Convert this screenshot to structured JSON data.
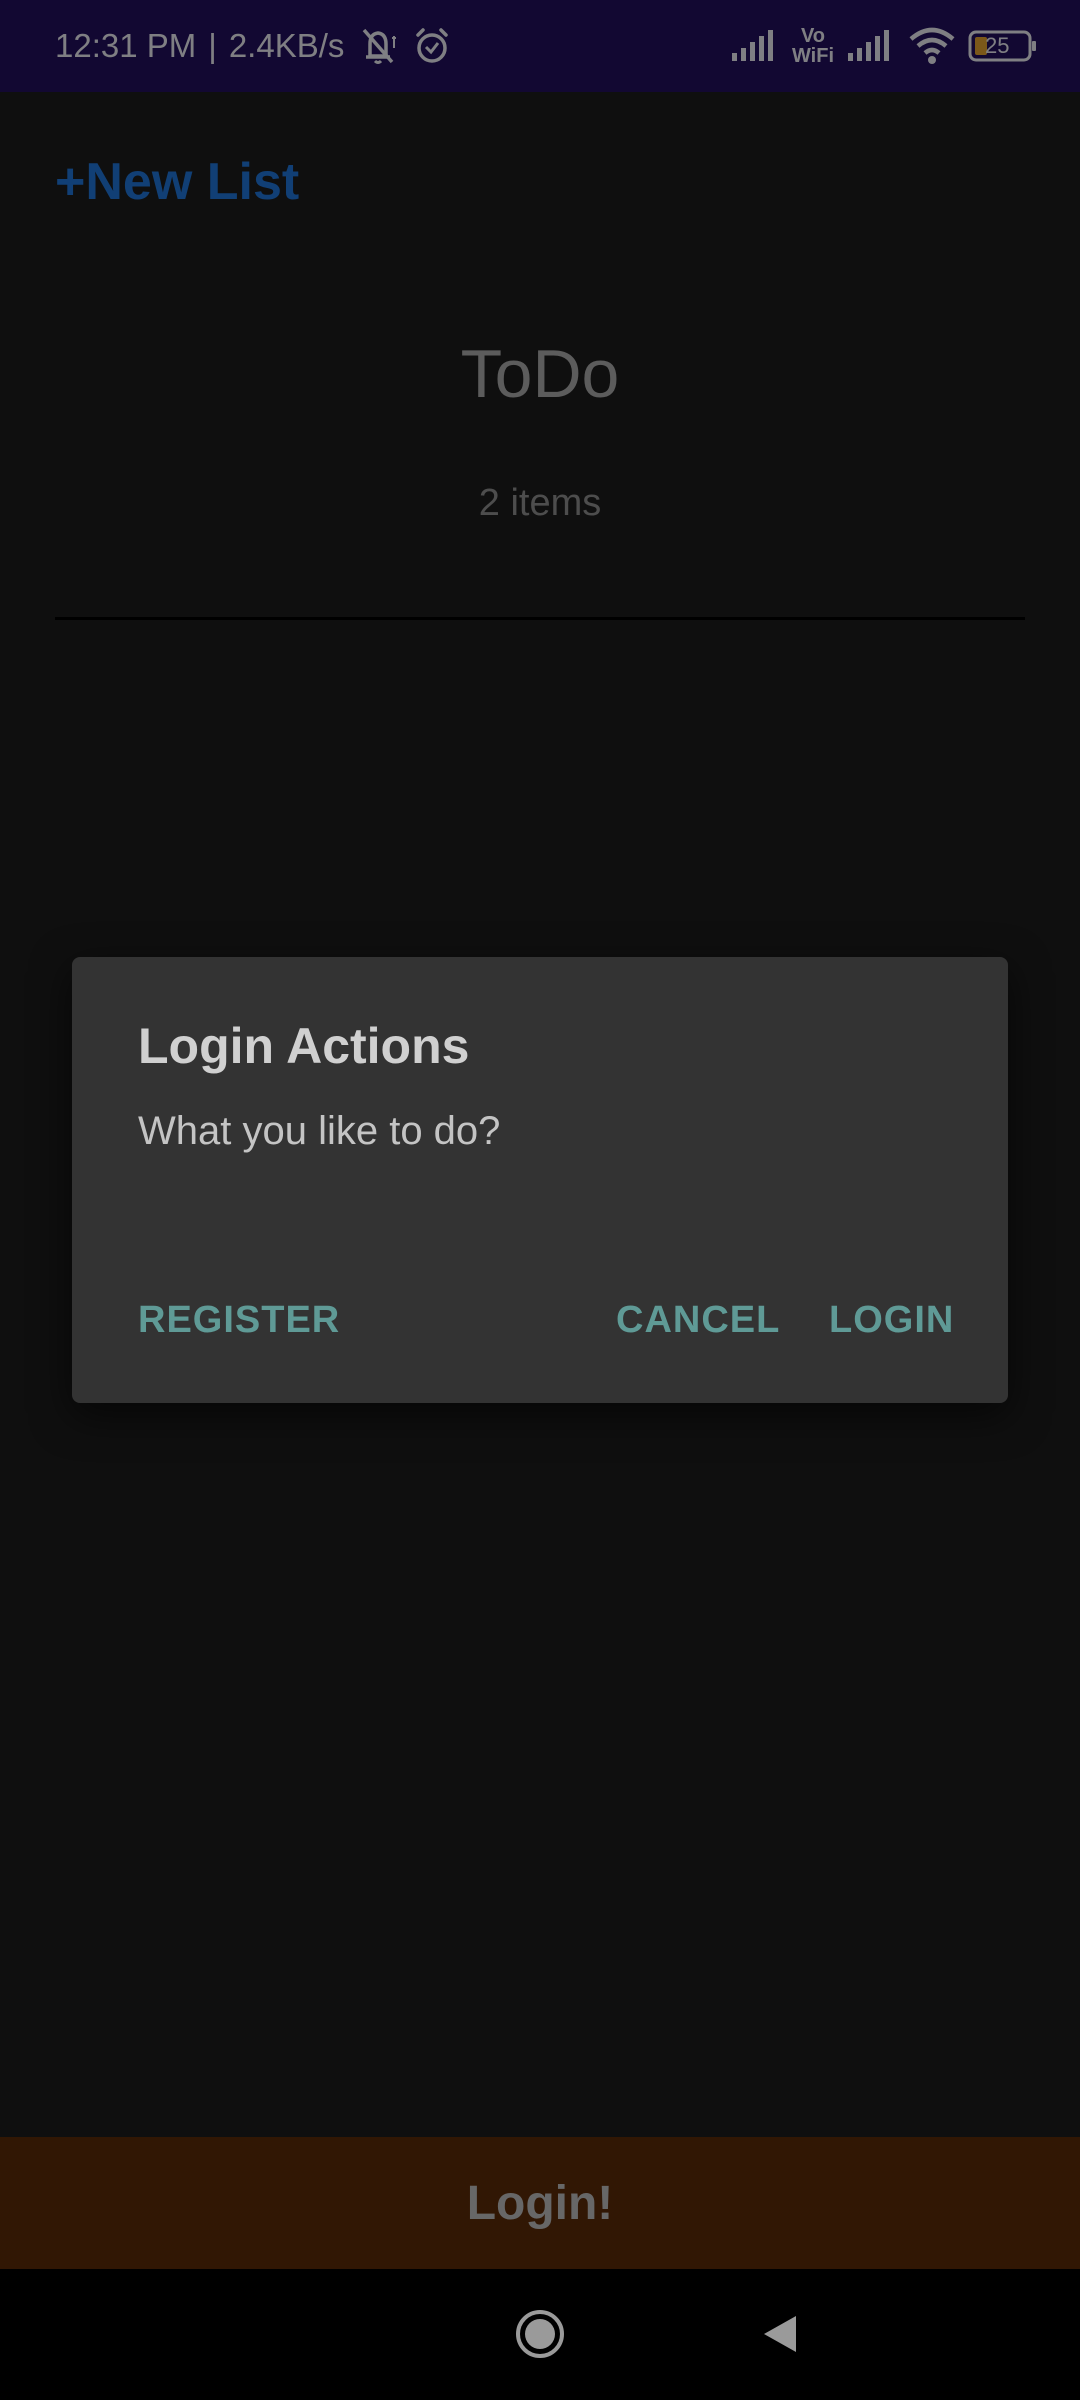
{
  "status_bar": {
    "time": "12:31 PM",
    "separator": "|",
    "network_speed": "2.4KB/s",
    "vowifi_label_top": "Vo",
    "vowifi_label_bottom": "WiFi",
    "battery_level": "25",
    "icons": [
      "bell-muted-icon",
      "alarm-icon",
      "signal-icon",
      "vowifi-icon",
      "signal-icon",
      "wifi-icon",
      "battery-icon"
    ]
  },
  "app": {
    "new_list_label": "+New List",
    "list_title": "ToDo",
    "list_count": "2 items",
    "login_button_label": "Login!"
  },
  "dialog": {
    "title": "Login Actions",
    "message": "What you like to do?",
    "buttons": {
      "register": "REGISTER",
      "cancel": "CANCEL",
      "login": "LOGIN"
    }
  },
  "navigation": {
    "icons": [
      "home-icon",
      "back-icon"
    ]
  },
  "colors": {
    "status_bar": "#22105c",
    "accent_link": "#1f74d6",
    "dialog_background": "#333333",
    "dialog_button": "#5f9a96",
    "login_bar": "#5a2a08",
    "background": "#1c1c1c"
  }
}
